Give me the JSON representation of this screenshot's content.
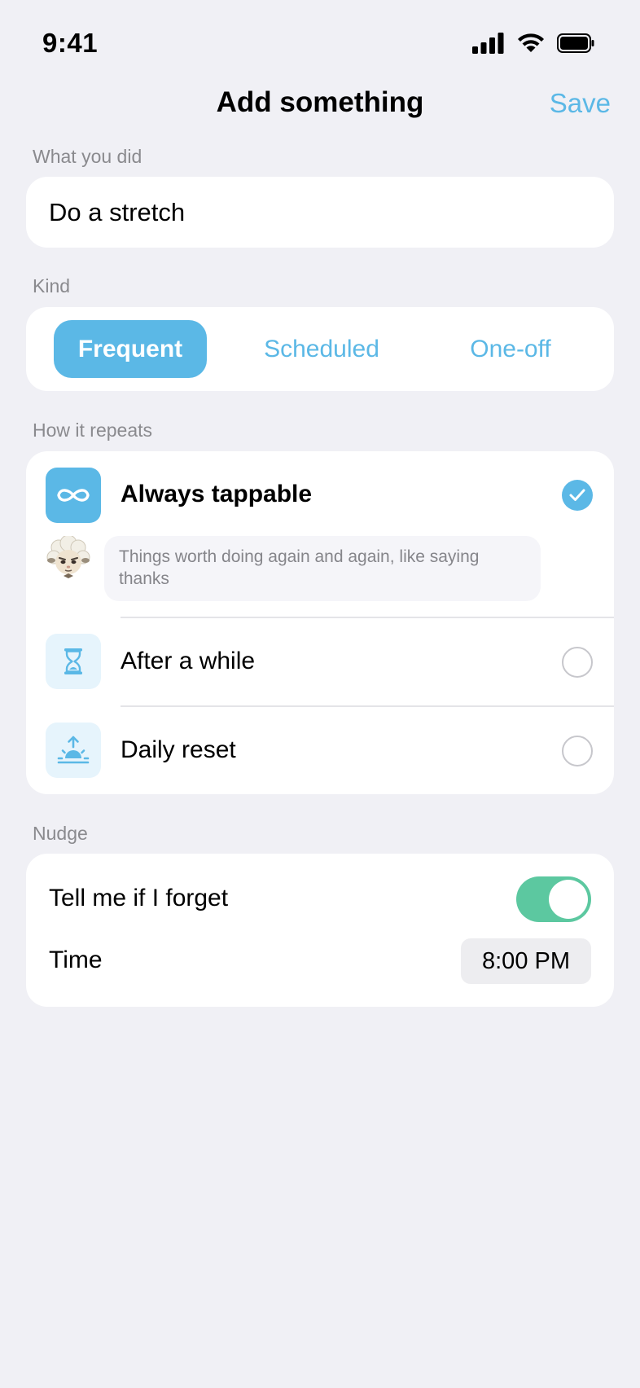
{
  "status_bar": {
    "time": "9:41"
  },
  "nav": {
    "title": "Add something",
    "save_label": "Save"
  },
  "what_you_did": {
    "label": "What you did",
    "value": "Do a stretch"
  },
  "kind": {
    "label": "Kind",
    "options": [
      "Frequent",
      "Scheduled",
      "One-off"
    ],
    "selected": "Frequent"
  },
  "repeats": {
    "label": "How it repeats",
    "options": [
      {
        "label": "Always tappable",
        "icon": "infinity-icon",
        "selected": true
      },
      {
        "label": "After a while",
        "icon": "hourglass-icon",
        "selected": false
      },
      {
        "label": "Daily reset",
        "icon": "sunrise-icon",
        "selected": false
      }
    ],
    "hint": "Things worth doing again and again, like saying thanks"
  },
  "nudge": {
    "label": "Nudge",
    "toggle_label": "Tell me if I forget",
    "toggle_on": true,
    "time_label": "Time",
    "time_value": "8:00 PM"
  },
  "colors": {
    "accent": "#5BB8E6",
    "toggle_on": "#5CC8A0",
    "background": "#F0F0F5"
  }
}
